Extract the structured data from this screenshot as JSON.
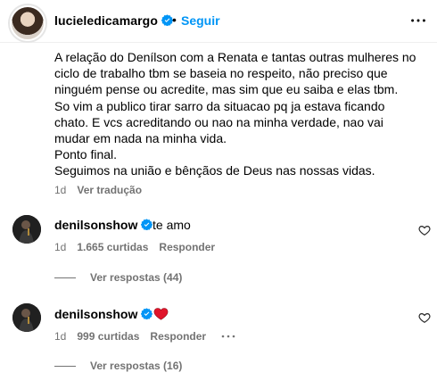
{
  "header": {
    "username": "lucieledicamargo",
    "separator": "•",
    "follow_label": "Seguir"
  },
  "caption": {
    "text": "A relação do Denílson com a Renata e tantas outras mulheres no\nciclo de trabalho tbm se baseia no respeito, não preciso que\nninguém pense ou acredite, mas sim que eu saiba e elas tbm.\nSo vim a publico tirar sarro da situacao pq ja estava ficando\nchato. E vcs acreditando ou nao na minha verdade, nao vai\nmudar em nada na minha vida.\nPonto final.\nSeguimos na união e bênçãos de Deus nas nossas vidas.",
    "time": "1d",
    "translate_label": "Ver tradução"
  },
  "comments": [
    {
      "username": "denilsonshow",
      "text": "te amo",
      "time": "1d",
      "likes": "1.665 curtidas",
      "reply_label": "Responder",
      "view_replies": "Ver respostas (44)"
    },
    {
      "username": "denilsonshow",
      "text": "",
      "emoji_icon": "red-heart-icon",
      "time": "1d",
      "likes": "999 curtidas",
      "reply_label": "Responder",
      "view_replies": "Ver respostas (16)"
    }
  ],
  "colors": {
    "verified": "#0095f6",
    "follow": "#0095f6",
    "muted": "#737373",
    "heart": "#ff3040"
  }
}
